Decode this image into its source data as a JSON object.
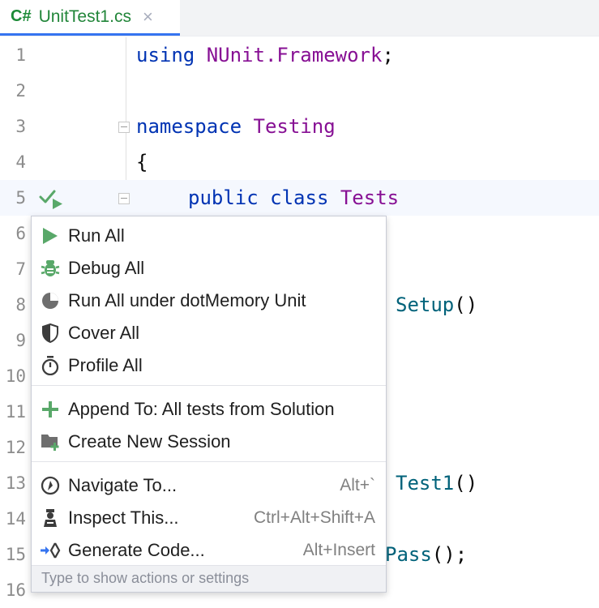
{
  "tab": {
    "lang_badge": "C#",
    "filename": "UnitTest1.cs",
    "close_glyph": "×"
  },
  "editor": {
    "line_numbers": [
      "1",
      "2",
      "3",
      "4",
      "5",
      "6",
      "7",
      "8",
      "9",
      "10",
      "11",
      "12",
      "13",
      "14",
      "15",
      "16"
    ],
    "line1": {
      "kw": "using",
      "ns": "NUnit.Framework",
      "semi": ";"
    },
    "line3": {
      "kw": "namespace",
      "name": "Testing"
    },
    "line4": {
      "brace": "{"
    },
    "line5": {
      "kw1": "public",
      "kw2": "class",
      "name": "Tests"
    },
    "line8": {
      "fn": "Setup",
      "parens": "()"
    },
    "line13": {
      "fn": "Test1",
      "parens": "()"
    },
    "line15": {
      "fn": "Pass",
      "rest": "();"
    },
    "gutter_icon": "run-tests-icon"
  },
  "popup": {
    "items": [
      {
        "label": "Run All",
        "icon": "run-icon"
      },
      {
        "label": "Debug All",
        "icon": "debug-bug-icon"
      },
      {
        "label": "Run All under dotMemory Unit",
        "icon": "dotmemory-icon"
      },
      {
        "label": "Cover All",
        "icon": "cover-shield-icon"
      },
      {
        "label": "Profile All",
        "icon": "profile-stopwatch-icon"
      },
      {
        "label": "Append To: All tests from Solution",
        "icon": "plus-icon"
      },
      {
        "label": "Create New Session",
        "icon": "folder-add-icon"
      },
      {
        "label": "Navigate To...",
        "shortcut": "Alt+`",
        "icon": "compass-icon"
      },
      {
        "label": "Inspect This...",
        "shortcut": "Ctrl+Alt+Shift+A",
        "icon": "inspector-icon"
      },
      {
        "label": "Generate Code...",
        "shortcut": "Alt+Insert",
        "icon": "generate-code-icon"
      }
    ],
    "footer_hint": "Type to show actions or settings"
  },
  "colors": {
    "accent": "#3574f0",
    "run_green": "#59a869",
    "keyword": "#0033b3",
    "type": "#871094",
    "method": "#00627a"
  }
}
